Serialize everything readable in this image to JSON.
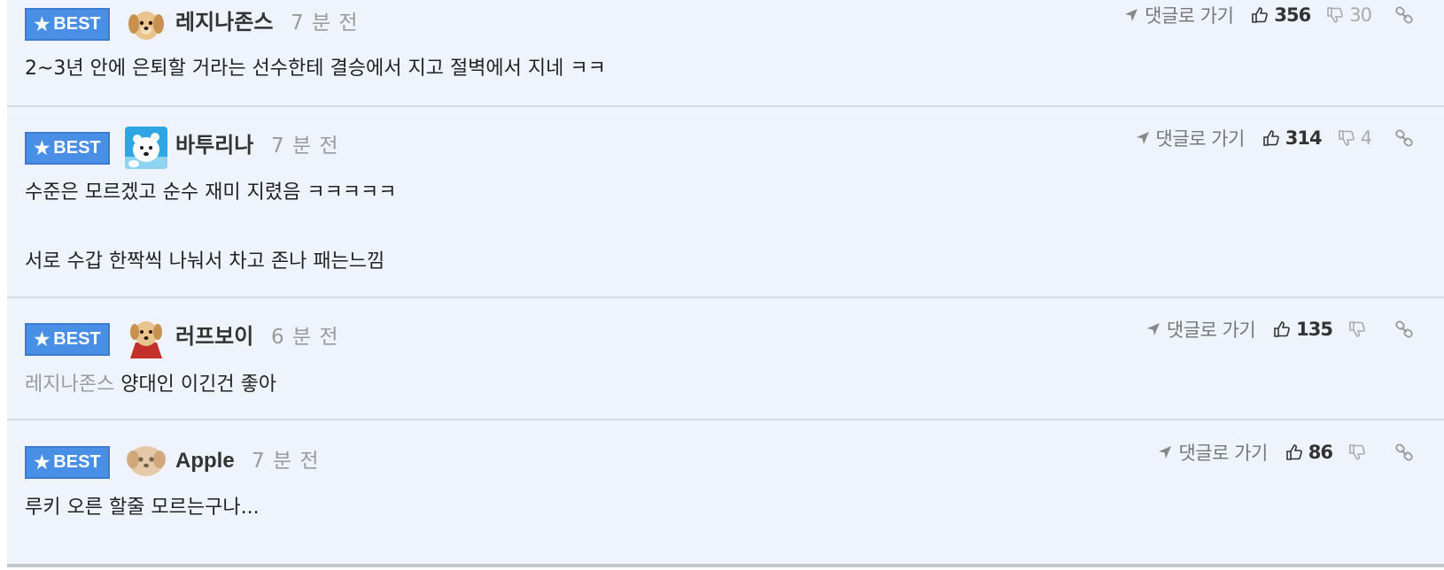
{
  "best_label": "BEST",
  "goto_label": "댓글로 가기",
  "comments": [
    {
      "nickname": "레지나존스",
      "time": "7 분 전",
      "avatar": "puppy-avatar",
      "lines": [
        "2~3년 안에 은퇴할 거라는 선수한테 결승에서 지고 절벽에서 지네 ㅋㅋ"
      ],
      "likes": "356",
      "dislikes": "30"
    },
    {
      "nickname": "바투리나",
      "time": "7 분 전",
      "avatar": "polar-bear-avatar",
      "lines": [
        "수준은 모르겠고 순수 재미 지렸음 ㅋㅋㅋㅋㅋ",
        "서로 수갑 한짝씩 나눠서 차고 존나 패는느낌"
      ],
      "likes": "314",
      "dislikes": "4"
    },
    {
      "nickname": "러프보이",
      "time": "6 분 전",
      "avatar": "puppy-cape-avatar",
      "mention": "레지나존스",
      "lines": [
        "양대인 이긴건 좋아"
      ],
      "likes": "135",
      "dislikes": ""
    },
    {
      "nickname": "Apple",
      "time": "7 분 전",
      "avatar": "blurred-puppy-avatar",
      "lines": [
        "루키 오른 할줄 모르는구나..."
      ],
      "likes": "86",
      "dislikes": ""
    }
  ],
  "colors": {
    "best_badge": "#4a8fe6",
    "background": "#eff4fc",
    "muted_text": "#9a9a9a"
  }
}
